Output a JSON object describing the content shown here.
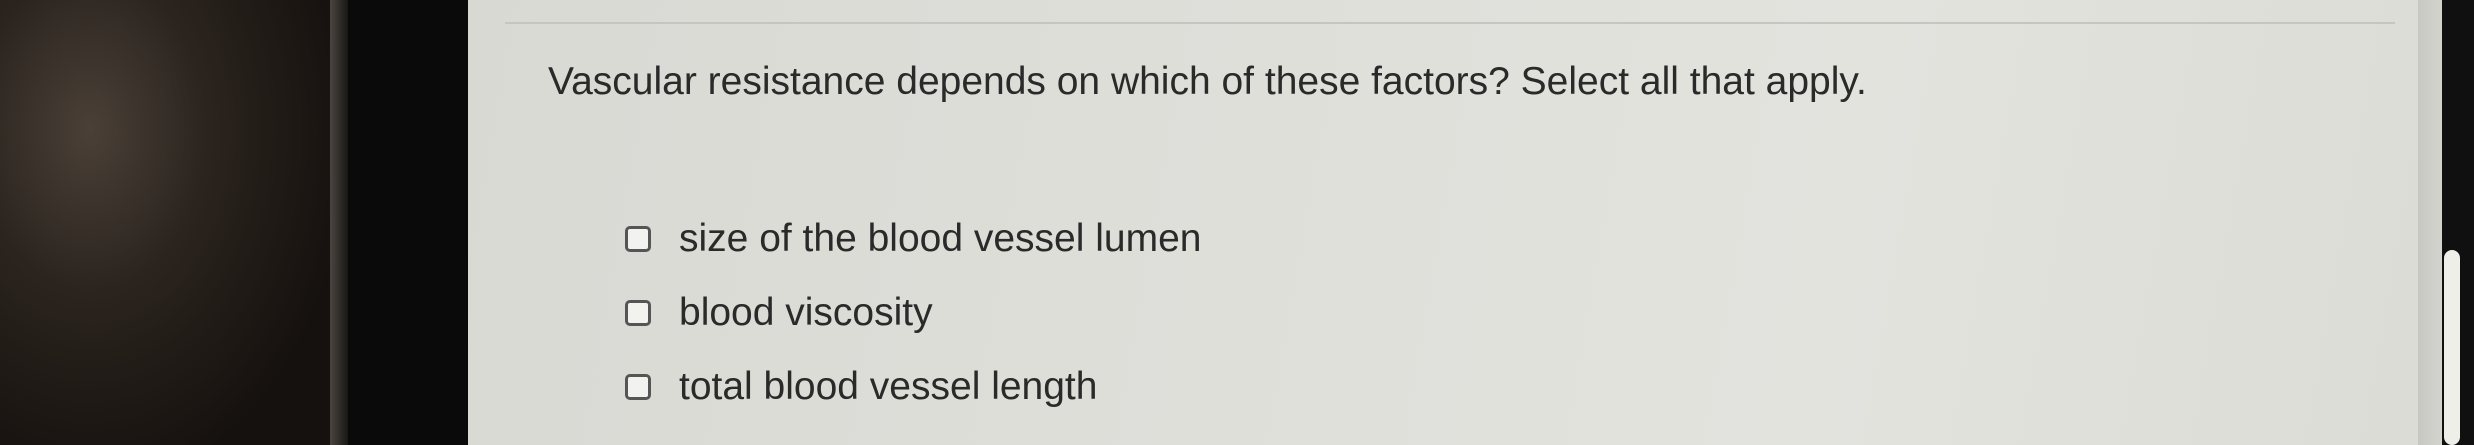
{
  "question": {
    "text": "Vascular resistance depends on which of these factors? Select all that apply."
  },
  "options": [
    {
      "label": "size of the blood vessel lumen",
      "checked": false
    },
    {
      "label": "blood viscosity",
      "checked": false
    },
    {
      "label": "total blood vessel length",
      "checked": false
    }
  ],
  "colors": {
    "page_background": "#dfdfda",
    "text": "#2a2a2a",
    "checkbox_border": "#555555"
  }
}
